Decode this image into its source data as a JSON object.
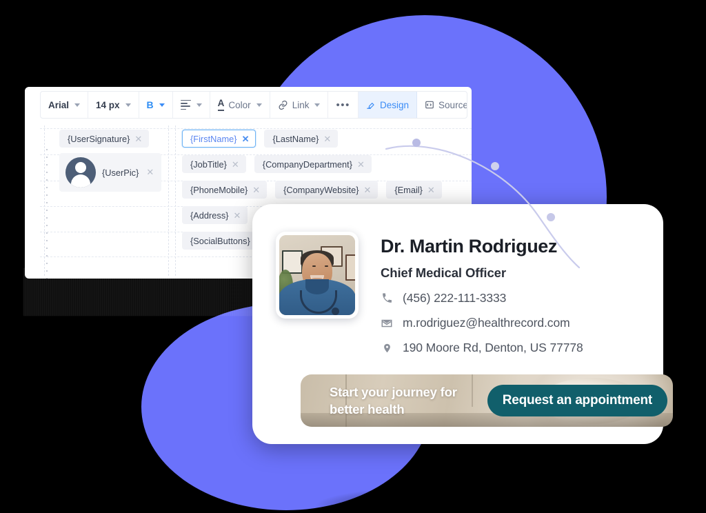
{
  "toolbar": {
    "font_family": "Arial",
    "font_size": "14 px",
    "bold_label": "B",
    "align_label": "",
    "color_label": "Color",
    "link_label": "Link",
    "more_label": "•••",
    "design_label": "Design",
    "source_label": "Source",
    "accent_blue": "#3b8cf6",
    "design_active_bg": "#eaf2fe"
  },
  "editor": {
    "signature_chip": "{UserSignature}",
    "userpic_chip": "{UserPic}",
    "remove_glyph": "✕",
    "chips": [
      {
        "label": "{FirstName}",
        "selected": true
      },
      {
        "label": "{LastName}",
        "selected": false
      },
      {
        "label": "{JobTitle}",
        "selected": false
      },
      {
        "label": "{CompanyDepartment}",
        "selected": false
      },
      {
        "label": "{PhoneMobile}",
        "selected": false
      },
      {
        "label": "{CompanyWebsite}",
        "selected": false
      },
      {
        "label": "{Email}",
        "selected": false
      },
      {
        "label": "{Address}",
        "selected": false
      },
      {
        "label": "{SocialButtons}",
        "selected": false
      }
    ]
  },
  "signature": {
    "name": "Dr. Martin Rodriguez",
    "role": "Chief Medical Officer",
    "phone": "(456) 222-111-3333",
    "email": "m.rodriguez@healthrecord.com",
    "address": "190 Moore Rd, Denton, US 77778",
    "photo_alt": "doctor-portrait",
    "cta": {
      "headline_line1": "Start your journey for",
      "headline_line2": "better health",
      "button_label": "Request an appointment",
      "button_color": "#115f6b"
    }
  },
  "decor": {
    "blob_color": "#6b72fb",
    "connector_color": "#c9cbec",
    "background_color": "#000000"
  }
}
